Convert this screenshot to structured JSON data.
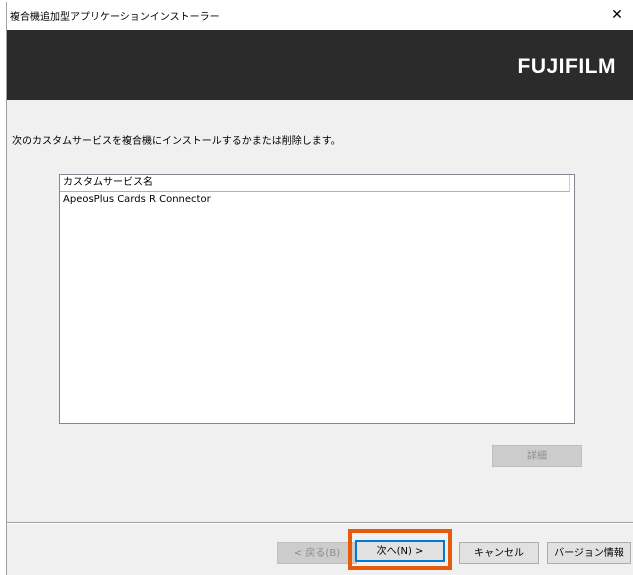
{
  "window": {
    "title": "複合機追加型アプリケーションインストーラー",
    "close_glyph": "✕"
  },
  "banner": {
    "logo_text": "FUJIFILM"
  },
  "main": {
    "instruction": "次のカスタムサービスを複合機にインストールするかまたは削除します。",
    "list": {
      "column_header": "カスタムサービス名",
      "items": [
        "ApeosPlus Cards R Connector"
      ]
    },
    "detail_button": "詳細"
  },
  "footer": {
    "back_button": "< 戻る(B)",
    "next_button": "次へ(N) >",
    "cancel_button": "キャンセル",
    "version_button": "バージョン情報"
  },
  "colors": {
    "banner_bg": "#2b2b2b",
    "highlight": "#e65a0c",
    "focus_border": "#0078d7"
  }
}
